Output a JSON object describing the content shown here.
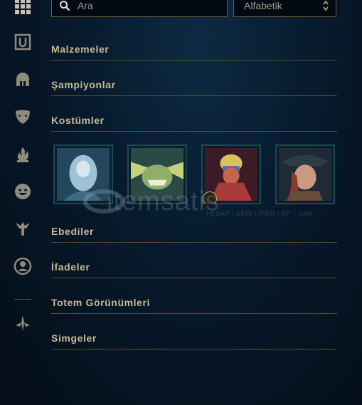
{
  "search": {
    "placeholder": "Ara"
  },
  "sort": {
    "selected": "Alfabetik"
  },
  "sidebar": {
    "items": [
      {
        "icon": "grid-icon"
      },
      {
        "icon": "inventory-icon"
      },
      {
        "icon": "helmet-icon"
      },
      {
        "icon": "mask-icon"
      },
      {
        "icon": "flame-icon"
      },
      {
        "icon": "emote-face-icon"
      },
      {
        "icon": "totem-icon"
      },
      {
        "icon": "profile-icon"
      },
      {
        "icon": "ward-icon"
      }
    ]
  },
  "sections": {
    "items_label": "Malzemeler",
    "champions_label": "Şampiyonlar",
    "skins_label": "Kostümler",
    "eternals_label": "Ebediler",
    "emotes_label": "İfadeler",
    "ward_skins_label": "Totem Görünümleri",
    "icons_label": "Simgeler"
  },
  "skins": [
    {
      "name": "skin-card-1",
      "accent": "#5f8fa8"
    },
    {
      "name": "skin-card-2",
      "accent": "#8fae6a"
    },
    {
      "name": "skin-card-3",
      "accent": "#a83a3a"
    },
    {
      "name": "skin-card-4",
      "accent": "#6a4a38"
    }
  ],
  "watermark": {
    "text": "itemsatis",
    "subtext": "HESAP | SKIN | ITEM | RP | .com"
  },
  "colors": {
    "gold": "#c8aa6e",
    "border_gold": "#5b4d2e",
    "bg": "#07192b"
  }
}
